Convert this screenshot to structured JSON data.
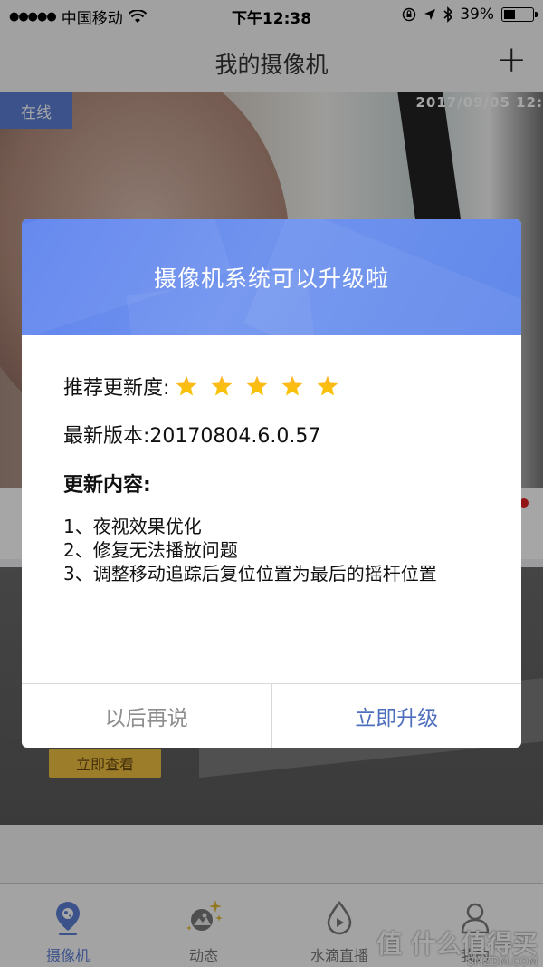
{
  "status_bar": {
    "signal_dots": "●●●●●",
    "carrier": "中国移动",
    "time": "下午12:38",
    "battery_percent": "39%",
    "battery_level": 0.39
  },
  "nav": {
    "title": "我的摄像机",
    "add_icon": "plus-icon"
  },
  "camera": {
    "status_badge": "在线",
    "timestamp_overlay": "2017/09/05  12:"
  },
  "promo": {
    "button_label": "立即查看"
  },
  "tabbar": {
    "tabs": [
      {
        "label": "摄像机",
        "icon": "camera-location-icon",
        "active": true
      },
      {
        "label": "动态",
        "icon": "moments-icon",
        "active": false
      },
      {
        "label": "水滴直播",
        "icon": "water-drop-play-icon",
        "active": false
      },
      {
        "label": "我的",
        "icon": "person-icon",
        "active": false
      }
    ]
  },
  "watermark": {
    "text": "值 什么值得买",
    "sub": "SMZDM.COM"
  },
  "dialog": {
    "title": "摄像机系统可以升级啦",
    "rating_label": "推荐更新度:",
    "rating_stars": 5,
    "rating_max": 5,
    "version_label": "最新版本:20170804.6.0.57",
    "changes_title": "更新内容:",
    "changes": [
      "1、夜视效果优化",
      "2、修复无法播放问题",
      "3、调整移动追踪后复位位置为最后的摇杆位置"
    ],
    "later_button": "以后再说",
    "upgrade_button": "立即升级",
    "accent_color": "#4e6fbd",
    "header_color": "#6189ea",
    "star_color": "#f5a623"
  }
}
